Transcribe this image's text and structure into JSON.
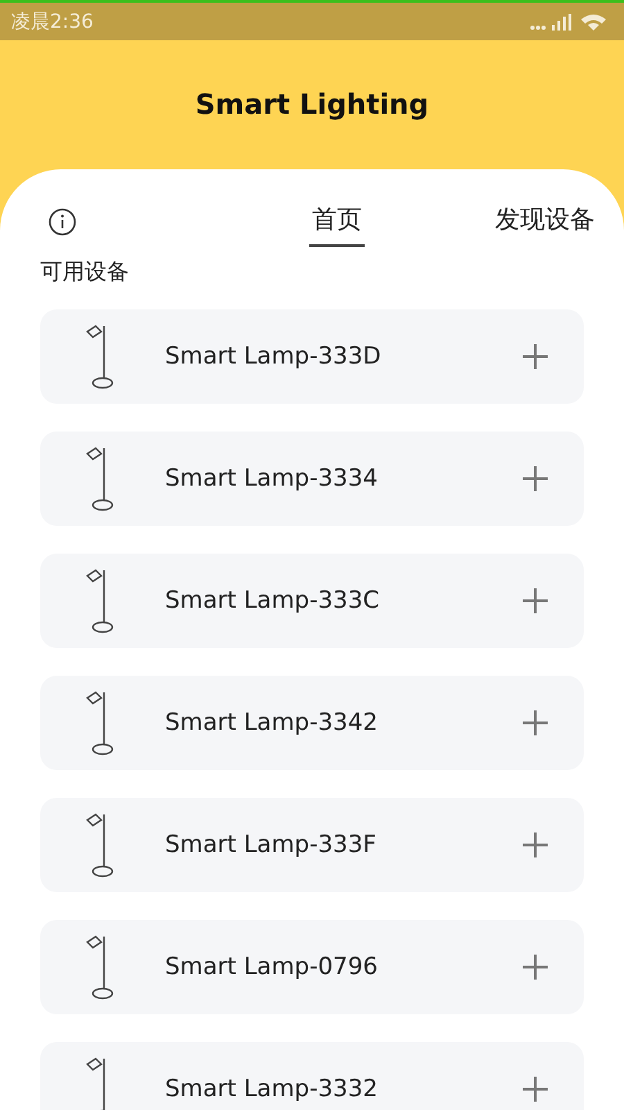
{
  "status_bar": {
    "time": "凌晨2:36"
  },
  "header": {
    "title": "Smart Lighting"
  },
  "tabs": [
    {
      "label": "首页",
      "selected": true
    },
    {
      "label": "发现设备",
      "selected": false
    }
  ],
  "section_title": "可用设备",
  "devices": [
    {
      "name": "Smart Lamp-333D"
    },
    {
      "name": "Smart Lamp-3334"
    },
    {
      "name": "Smart Lamp-333C"
    },
    {
      "name": "Smart Lamp-3342"
    },
    {
      "name": "Smart Lamp-333F"
    },
    {
      "name": "Smart Lamp-0796"
    },
    {
      "name": "Smart Lamp-3332"
    }
  ]
}
